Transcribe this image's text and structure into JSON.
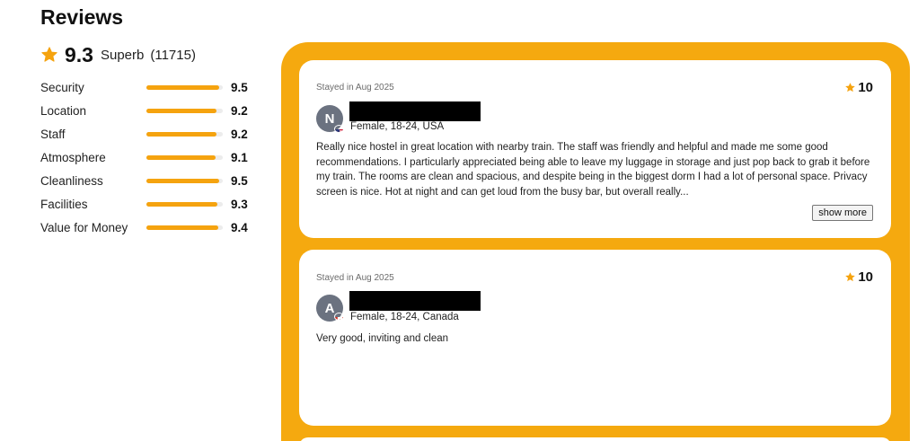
{
  "header": {
    "title": "Reviews"
  },
  "overall": {
    "score": "9.3",
    "label": "Superb",
    "count": "(11715)"
  },
  "categories": [
    {
      "name": "Security",
      "value": "9.5",
      "fill": 0.95
    },
    {
      "name": "Location",
      "value": "9.2",
      "fill": 0.92
    },
    {
      "name": "Staff",
      "value": "9.2",
      "fill": 0.92
    },
    {
      "name": "Atmosphere",
      "value": "9.1",
      "fill": 0.91
    },
    {
      "name": "Cleanliness",
      "value": "9.5",
      "fill": 0.95
    },
    {
      "name": "Facilities",
      "value": "9.3",
      "fill": 0.93
    },
    {
      "name": "Value for Money",
      "value": "9.4",
      "fill": 0.94
    }
  ],
  "reviews": [
    {
      "stayed": "Stayed in Aug 2025",
      "rating": "10",
      "initial": "N",
      "flag": "us-flag-icon",
      "demographics": "Female, 18-24, USA",
      "text": "Really nice hostel in great location with nearby train. The staff was friendly and helpful and made me some good recommendations. I particularly appreciated being able to leave my luggage in storage and just pop back to grab it before my train. The rooms are clean and spacious, and despite being in the biggest dorm I had a lot of personal space. Privacy screen is nice. Hot at night and can get loud from the busy bar, but overall really...",
      "show_more": "show more"
    },
    {
      "stayed": "Stayed in Aug 2025",
      "rating": "10",
      "initial": "A",
      "flag": "canada-flag-icon",
      "demographics": "Female, 18-24, Canada",
      "text": "Very good, inviting and clean"
    }
  ],
  "colors": {
    "accent": "#f5a90f",
    "bar_fill": "#f5a30f",
    "avatar": "#6b7280"
  }
}
